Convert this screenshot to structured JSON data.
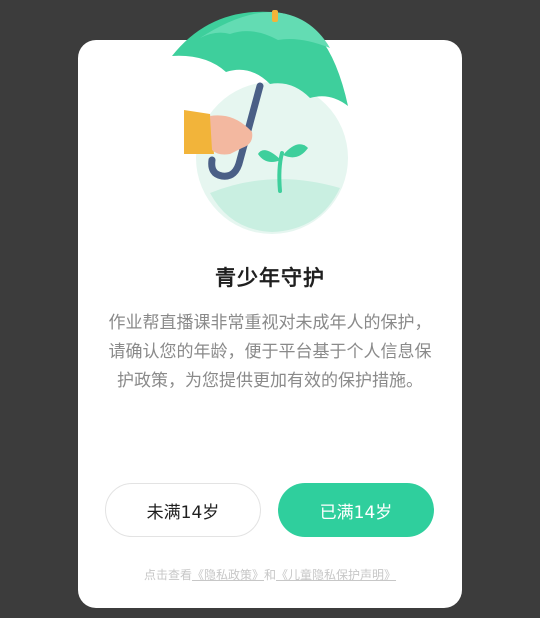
{
  "dialog": {
    "title": "青少年守护",
    "description": "作业帮直播课非常重视对未成年人的保护，请确认您的年龄，便于平台基于个人信息保护政策，为您提供更加有效的保护措施。",
    "buttons": {
      "under_14": "未满14岁",
      "over_14": "已满14岁"
    },
    "footer": {
      "prefix": "点击查看",
      "privacy_policy_link": "《隐私政策》",
      "connector": "和",
      "child_privacy_link": "《儿童隐私保护声明》"
    }
  },
  "illustration": {
    "icon": "umbrella-protection-icon",
    "colors": {
      "umbrella": "#3ecf9c",
      "circle": "#e6f6f0",
      "sleeve": "#f2b43a"
    }
  },
  "colors": {
    "overlay": "#3c3c3c",
    "accent": "#2fcf9d",
    "text_primary": "#1f1f1f",
    "text_secondary": "#8a8a8a",
    "link": "#c7c7c7"
  }
}
